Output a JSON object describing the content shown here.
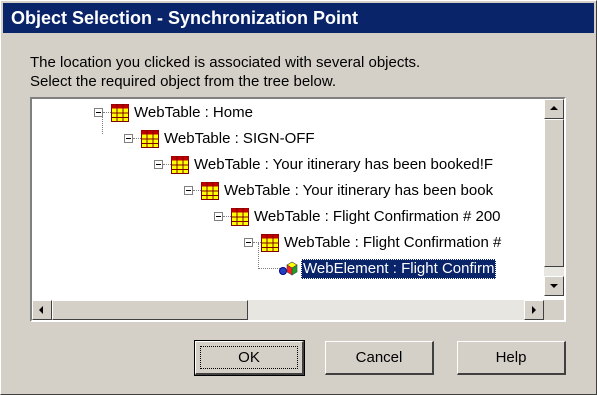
{
  "window": {
    "title": "Object Selection - Synchronization Point"
  },
  "instructions": {
    "line1": "The location you clicked is associated with several objects.",
    "line2": "Select the required object from the tree below."
  },
  "tree": {
    "nodes": [
      {
        "label": "WebTable : Home",
        "icon": "webtable-icon",
        "expanded": true,
        "selected": false
      },
      {
        "label": "WebTable : SIGN-OFF",
        "icon": "webtable-icon",
        "expanded": true,
        "selected": false
      },
      {
        "label": "WebTable : Your itinerary has been booked!F",
        "icon": "webtable-icon",
        "expanded": true,
        "selected": false
      },
      {
        "label": "WebTable : Your itinerary has been book",
        "icon": "webtable-icon",
        "expanded": true,
        "selected": false
      },
      {
        "label": "WebTable :  Flight Confirmation # 200",
        "icon": "webtable-icon",
        "expanded": true,
        "selected": false
      },
      {
        "label": "WebTable :  Flight Confirmation #",
        "icon": "webtable-icon",
        "expanded": true,
        "selected": false
      },
      {
        "label": "WebElement :  Flight Confirm",
        "icon": "webelement-icon",
        "expanded": false,
        "selected": true
      }
    ]
  },
  "buttons": {
    "ok": "OK",
    "cancel": "Cancel",
    "help": "Help"
  },
  "colors": {
    "titlebar": "#0a246a",
    "selection": "#0a246a",
    "face": "#d4d0c8"
  }
}
